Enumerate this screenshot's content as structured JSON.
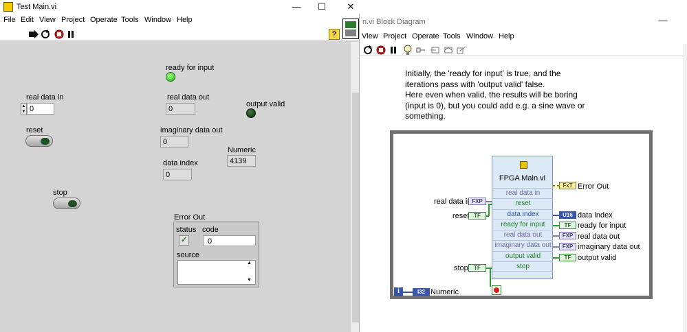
{
  "front_panel": {
    "title": "Test Main.vi",
    "window_buttons": {
      "minimize": "—",
      "maximize": "☐",
      "close": "✕"
    },
    "menu": [
      "File",
      "Edit",
      "View",
      "Project",
      "Operate",
      "Tools",
      "Window",
      "Help"
    ],
    "help_glyph": "?",
    "controls": {
      "real_data_in": {
        "label": "real data in",
        "value": "0"
      },
      "reset": {
        "label": "reset"
      },
      "stop": {
        "label": "stop"
      },
      "ready_for_input": {
        "label": "ready for input",
        "state": "on"
      },
      "real_data_out": {
        "label": "real data out",
        "value": "0"
      },
      "output_valid": {
        "label": "output valid",
        "state": "off"
      },
      "imaginary_data_out": {
        "label": "imaginary data out",
        "value": "0"
      },
      "numeric": {
        "label": "Numeric",
        "value": "4139"
      },
      "data_index": {
        "label": "data index",
        "value": "0"
      },
      "error_out": {
        "label": "Error Out",
        "status_label": "status",
        "code_label": "code",
        "code_value": "0",
        "source_label": "source",
        "source_value": ""
      }
    }
  },
  "block_diagram": {
    "title": "n.vi Block Diagram",
    "menu": [
      "View",
      "Project",
      "Operate",
      "Tools",
      "Window",
      "Help"
    ],
    "comment": [
      "Initially, the 'ready for input' is true, and the",
      "iterations pass with 'output valid' false.",
      "Here even when valid, the results will be boring",
      "(input is 0), but you could add e.g. a sine wave or",
      "something."
    ],
    "subvi": {
      "name": "FPGA Main.vi",
      "terminals": [
        "real data in",
        "reset",
        "data index",
        "ready for input",
        "real data out",
        "imaginary data out",
        "output valid",
        "stop"
      ]
    },
    "inputs": {
      "real_data_in": {
        "label": "real data in",
        "type": "FXP"
      },
      "reset": {
        "label": "reset",
        "type": "TF"
      },
      "stop": {
        "label": "stop",
        "type": "TF"
      }
    },
    "outputs": {
      "error_out": {
        "label": "Error Out",
        "type": "FxT"
      },
      "data_index": {
        "label": "data index",
        "type": "U16"
      },
      "ready_for_input": {
        "label": "ready for input",
        "type": "TF"
      },
      "real_data_out": {
        "label": "real data out",
        "type": "FXP"
      },
      "imaginary_data_out": {
        "label": "imaginary data out",
        "type": "FXP"
      },
      "output_valid": {
        "label": "output valid",
        "type": "TF"
      }
    },
    "iteration": {
      "glyph": "i",
      "label": "Numeric",
      "type": "I32"
    }
  },
  "colors": {
    "led_on": "#4fe23a",
    "led_off": "#1c4a1c",
    "panel_bg": "#d4d4d4",
    "subvi_bg": "#dbe8f6",
    "bool_wire": "#2f9a2f",
    "fxp_wire": "#8080b8",
    "int_wire": "#3856a8"
  }
}
